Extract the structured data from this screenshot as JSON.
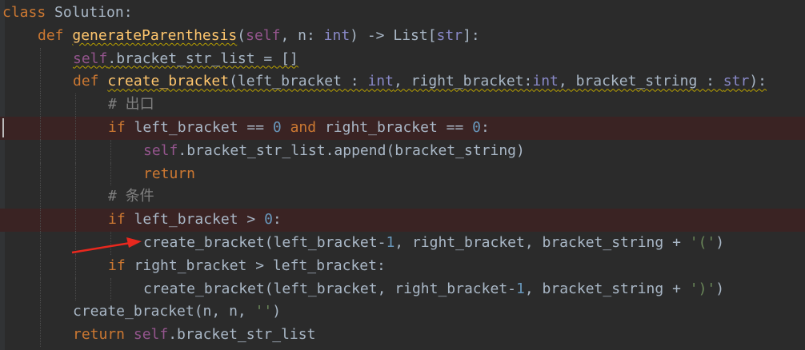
{
  "code_lines": [
    {
      "indent": 0,
      "breakpoint": false,
      "tokens": [
        {
          "t": "class",
          "c": "kw"
        },
        {
          "t": " Solution:",
          "c": "plain"
        }
      ]
    },
    {
      "indent": 1,
      "breakpoint": false,
      "tokens": [
        {
          "t": "def ",
          "c": "kw"
        },
        {
          "t": "generateParenthesis",
          "c": "fn warn"
        },
        {
          "t": "(",
          "c": "plain"
        },
        {
          "t": "self",
          "c": "self"
        },
        {
          "t": ", n: ",
          "c": "plain"
        },
        {
          "t": "int",
          "c": "bi"
        },
        {
          "t": ") -> List[",
          "c": "plain"
        },
        {
          "t": "str",
          "c": "bi"
        },
        {
          "t": "]:",
          "c": "plain"
        }
      ]
    },
    {
      "indent": 2,
      "breakpoint": false,
      "tokens": [
        {
          "t": "self",
          "c": "self warn"
        },
        {
          "t": ".bracket_str_list = []",
          "c": "plain warn"
        }
      ]
    },
    {
      "indent": 2,
      "breakpoint": false,
      "tokens": [
        {
          "t": "def ",
          "c": "kw"
        },
        {
          "t": "create_bracket",
          "c": "fn warn"
        },
        {
          "t": "(left_bracket : ",
          "c": "plain warn"
        },
        {
          "t": "int",
          "c": "bi warn"
        },
        {
          "t": ", right_bracket:",
          "c": "plain warn"
        },
        {
          "t": "int",
          "c": "bi warn"
        },
        {
          "t": ", bracket_string : ",
          "c": "plain warn"
        },
        {
          "t": "str",
          "c": "bi warn"
        },
        {
          "t": "):",
          "c": "plain warn"
        }
      ]
    },
    {
      "indent": 3,
      "breakpoint": false,
      "tokens": [
        {
          "t": "# 出口",
          "c": "cmt"
        }
      ]
    },
    {
      "indent": 3,
      "breakpoint": true,
      "caret": true,
      "tokens": [
        {
          "t": "if ",
          "c": "kw"
        },
        {
          "t": "left_bracket == ",
          "c": "plain"
        },
        {
          "t": "0",
          "c": "num"
        },
        {
          "t": " and ",
          "c": "kw"
        },
        {
          "t": "right_bracket == ",
          "c": "plain"
        },
        {
          "t": "0",
          "c": "num"
        },
        {
          "t": ":",
          "c": "plain"
        }
      ]
    },
    {
      "indent": 4,
      "breakpoint": false,
      "tokens": [
        {
          "t": "self",
          "c": "self"
        },
        {
          "t": ".bracket_str_list.append(bracket_string)",
          "c": "plain"
        }
      ]
    },
    {
      "indent": 4,
      "breakpoint": false,
      "tokens": [
        {
          "t": "return",
          "c": "kw"
        }
      ]
    },
    {
      "indent": 3,
      "breakpoint": false,
      "tokens": [
        {
          "t": "# 条件",
          "c": "cmt"
        }
      ]
    },
    {
      "indent": 3,
      "breakpoint": true,
      "tokens": [
        {
          "t": "if ",
          "c": "kw"
        },
        {
          "t": "left_bracket > ",
          "c": "plain"
        },
        {
          "t": "0",
          "c": "num"
        },
        {
          "t": ":",
          "c": "plain"
        }
      ]
    },
    {
      "indent": 4,
      "breakpoint": false,
      "tokens": [
        {
          "t": "create_bracket(left_bracket-",
          "c": "plain"
        },
        {
          "t": "1",
          "c": "num"
        },
        {
          "t": ", right_bracket, bracket_string + ",
          "c": "plain"
        },
        {
          "t": "'('",
          "c": "str"
        },
        {
          "t": ")",
          "c": "plain"
        }
      ]
    },
    {
      "indent": 3,
      "breakpoint": false,
      "tokens": [
        {
          "t": "if ",
          "c": "kw"
        },
        {
          "t": "right_bracket > left_bracket:",
          "c": "plain"
        }
      ]
    },
    {
      "indent": 4,
      "breakpoint": false,
      "tokens": [
        {
          "t": "create_bracket(left_bracket, right_bracket-",
          "c": "plain"
        },
        {
          "t": "1",
          "c": "num"
        },
        {
          "t": ", bracket_string + ",
          "c": "plain"
        },
        {
          "t": "')'",
          "c": "str"
        },
        {
          "t": ")",
          "c": "plain"
        }
      ]
    },
    {
      "indent": 2,
      "breakpoint": false,
      "tokens": [
        {
          "t": "create_bracket(n, n, ",
          "c": "plain"
        },
        {
          "t": "''",
          "c": "str"
        },
        {
          "t": ")",
          "c": "plain"
        }
      ]
    },
    {
      "indent": 2,
      "breakpoint": false,
      "tokens": [
        {
          "t": "return ",
          "c": "kw"
        },
        {
          "t": "self",
          "c": "self"
        },
        {
          "t": ".bracket_str_list",
          "c": "plain"
        }
      ]
    }
  ],
  "colors": {
    "background": "#2b2b2b",
    "keyword": "#cc7832",
    "function": "#ffc66d",
    "self": "#94558d",
    "number": "#6897bb",
    "string": "#6a8759",
    "comment": "#808080",
    "builtin": "#8888c6",
    "text": "#a9b7c6",
    "breakpoint_line": "#3a2323",
    "annotation_arrow": "#e8281e"
  },
  "annotation": {
    "type": "arrow",
    "icon": "red-arrow-icon",
    "points_to_line": 11
  }
}
